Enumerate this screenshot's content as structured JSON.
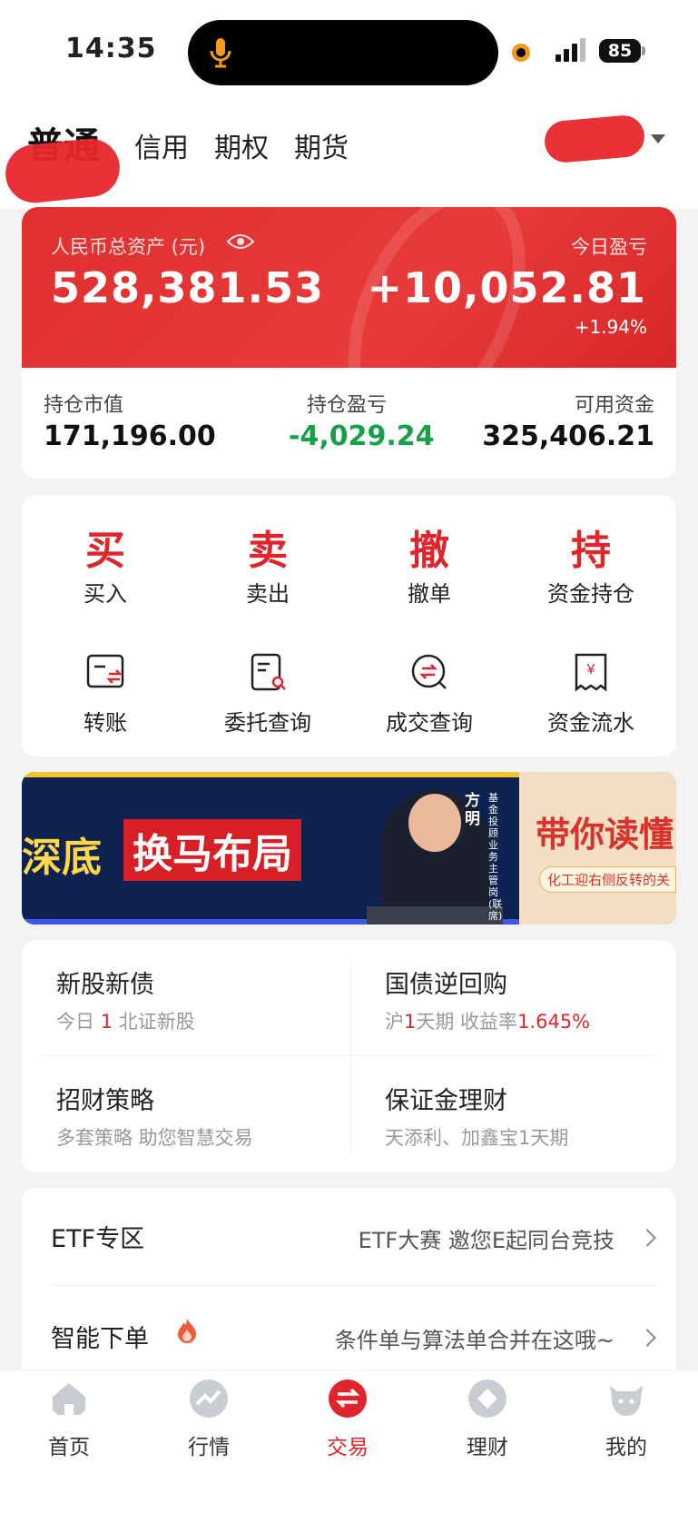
{
  "status": {
    "time": "14:35",
    "battery": "85"
  },
  "header": {
    "tabs": [
      "普通",
      "信用",
      "期权",
      "期货"
    ],
    "active_tab": "普通"
  },
  "asset_card": {
    "total_label": "人民币总资产 (元)",
    "total_value": "528,381.53",
    "today_label": "今日盈亏",
    "today_value": "+10,052.81",
    "today_pct": "+1.94%"
  },
  "summary": {
    "items": [
      {
        "label": "持仓市值",
        "value": "171,196.00"
      },
      {
        "label": "持仓盈亏",
        "value": "-4,029.24"
      },
      {
        "label": "可用资金",
        "value": "325,406.21"
      }
    ]
  },
  "actions": [
    {
      "glyph": "买",
      "label": "买入"
    },
    {
      "glyph": "卖",
      "label": "卖出"
    },
    {
      "glyph": "撤",
      "label": "撤单"
    },
    {
      "glyph": "持",
      "label": "资金持仓"
    }
  ],
  "tools": [
    {
      "icon": "transfer-icon",
      "label": "转账"
    },
    {
      "icon": "order-query-icon",
      "label": "委托查询"
    },
    {
      "icon": "deal-query-icon",
      "label": "成交查询"
    },
    {
      "icon": "fund-flow-icon",
      "label": "资金流水"
    }
  ],
  "banner": {
    "left_text": "深底",
    "main_text": "换马布局",
    "person_name": "方明",
    "person_title": "基金投顾业务主管岗(联席)",
    "right_title": "带你读懂",
    "right_sub": "化工迎右侧反转的关"
  },
  "services": [
    {
      "title": "新股新债",
      "sub_pre": "今日 ",
      "sub_hl": "1",
      "sub_post": " 北证新股"
    },
    {
      "title": "国债逆回购",
      "sub_pre": "沪",
      "sub_hl": "1",
      "sub_mid": "天期 收益率",
      "sub_hl2": "1.645%"
    },
    {
      "title": "招财策略",
      "sub": "多套策略 助您智慧交易"
    },
    {
      "title": "保证金理财",
      "sub": "天添利、加鑫宝1天期"
    }
  ],
  "rows": [
    {
      "title": "ETF专区",
      "desc": "ETF大赛 邀您E起同台竞技"
    },
    {
      "title": "智能下单",
      "desc": "条件单与算法单合并在这哦~"
    }
  ],
  "bottom_nav": [
    {
      "icon": "home-icon",
      "label": "首页"
    },
    {
      "icon": "market-icon",
      "label": "行情"
    },
    {
      "icon": "trade-icon",
      "label": "交易"
    },
    {
      "icon": "wealth-icon",
      "label": "理财"
    },
    {
      "icon": "profile-icon",
      "label": "我的"
    }
  ],
  "colors": {
    "accent": "#e0242c",
    "loss": "#16a04a"
  }
}
